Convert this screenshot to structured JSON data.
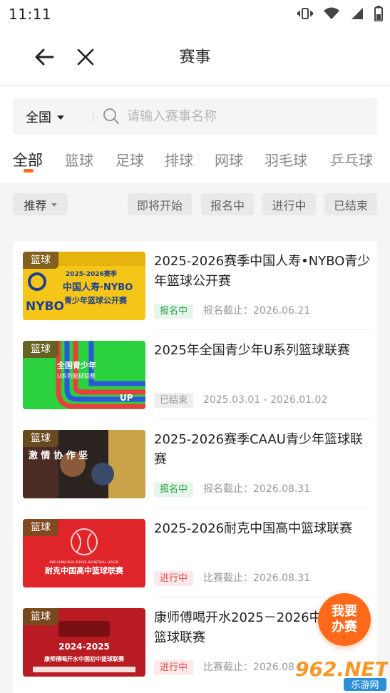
{
  "status_bar": {
    "time": "11:11"
  },
  "nav": {
    "title": "赛事"
  },
  "search": {
    "region": "全国",
    "placeholder": "请输入赛事名称"
  },
  "sport_tabs": [
    "全部",
    "篮球",
    "足球",
    "排球",
    "网球",
    "羽毛球",
    "乒乓球"
  ],
  "active_tab_index": 0,
  "filters": {
    "sort_label": "推荐",
    "chips": [
      "即将开始",
      "报名中",
      "进行中",
      "已结束"
    ]
  },
  "events": [
    {
      "sport": "篮球",
      "title": "2025-2026赛季中国人寿•NYBO青少年篮球公开赛",
      "status": "报名中",
      "status_type": "green",
      "date": "报名截止：2026.06.21"
    },
    {
      "sport": "篮球",
      "title": "2025年全国青少年U系列篮球联赛",
      "status": "已结束",
      "status_type": "grey",
      "date": "2025.03.01 - 2026.01.02"
    },
    {
      "sport": "篮球",
      "title": "2025-2026赛季CAAU青少年篮球联赛",
      "status": "报名中",
      "status_type": "green",
      "date": "报名截止：2026.08.31"
    },
    {
      "sport": "篮球",
      "title": "2025-2026耐克中国高中篮球联赛",
      "status": "进行中",
      "status_type": "red",
      "date": "比赛截止：2026.08.31"
    },
    {
      "sport": "篮球",
      "title": "康师傅喝开水2025－2026中国初中篮球联赛",
      "status": "进行中",
      "status_type": "red",
      "date": "比赛截止：2026.08"
    }
  ],
  "thumb_text": {
    "nybo_season": "2025-2026赛季",
    "nybo_line1": "中国人寿·NYBO",
    "nybo_line2": "青少年篮球公开赛",
    "nybo_logo": "NYBO",
    "u_line1": "全国青少年",
    "u_line2": "U系列篮球联赛",
    "u_logo": "UP",
    "caau_text": "激 情 协 作 坚",
    "nike_league_en": "NIKE CHINA HIGH SCHOOL BASKETBALL LEAGUE",
    "nike_league_cn": "耐克中国高中篮球联赛",
    "ksf_years": "2024-2025",
    "ksf_name": "康师傅喝开水中国初中篮球联赛"
  },
  "fab": {
    "line1": "我要",
    "line2": "办赛"
  },
  "watermark": {
    "brand": "962.NET",
    "sub": "乐游网"
  },
  "colors": {
    "accent": "#ff6a1a",
    "green": "#2fa24a",
    "red": "#e34b4b",
    "grey": "#999999"
  }
}
